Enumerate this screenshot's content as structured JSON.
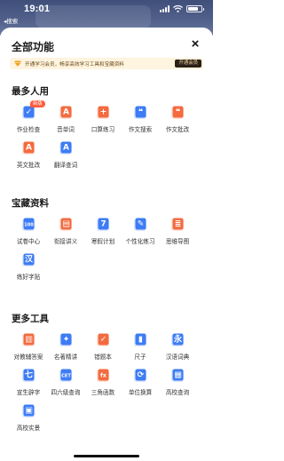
{
  "status": {
    "time": "19:01",
    "back_label": "◂搜索"
  },
  "sheet": {
    "title": "全部功能",
    "close": "×",
    "promo": {
      "text": "开通学习会员，畅享高效学习工具和宝藏资料",
      "button": "开通会员"
    }
  },
  "sections": [
    {
      "title": "最多人用",
      "items": [
        {
          "label": "作业检查",
          "icon": "homework-check-icon",
          "badge": "新版"
        },
        {
          "label": "音单词",
          "icon": "word-dictation-icon"
        },
        {
          "label": "口算练习",
          "icon": "mental-math-icon"
        },
        {
          "label": "作文搜索",
          "icon": "essay-search-icon"
        },
        {
          "label": "作文批改",
          "icon": "essay-correction-icon"
        },
        {
          "label": "英文批改",
          "icon": "english-correction-icon"
        },
        {
          "label": "翻译查词",
          "icon": "translate-icon"
        }
      ]
    },
    {
      "title": "宝藏资料",
      "items": [
        {
          "label": "试卷中心",
          "icon": "exam-paper-icon"
        },
        {
          "label": "衔接讲义",
          "icon": "bridge-notes-icon"
        },
        {
          "label": "寒假计划",
          "icon": "winter-plan-icon"
        },
        {
          "label": "个性化练习",
          "icon": "personal-practice-icon"
        },
        {
          "label": "思维导图",
          "icon": "mind-map-icon"
        },
        {
          "label": "练好字贴",
          "icon": "copybook-icon"
        }
      ]
    },
    {
      "title": "更多工具",
      "items": [
        {
          "label": "对教辅答案",
          "icon": "answer-book-icon"
        },
        {
          "label": "名著精讲",
          "icon": "classics-icon"
        },
        {
          "label": "错题本",
          "icon": "mistake-book-icon"
        },
        {
          "label": "尺子",
          "icon": "ruler-icon"
        },
        {
          "label": "汉语词典",
          "icon": "dictionary-icon"
        },
        {
          "label": "宣生辟字",
          "icon": "rare-char-icon"
        },
        {
          "label": "四六级查询",
          "icon": "cet-icon"
        },
        {
          "label": "三角函数",
          "icon": "trig-icon"
        },
        {
          "label": "单位换算",
          "icon": "unit-convert-icon"
        },
        {
          "label": "高校查询",
          "icon": "university-icon"
        },
        {
          "label": "高校实景",
          "icon": "campus-view-icon"
        }
      ]
    }
  ],
  "colors": {
    "blue": "#3d7cf5",
    "orange": "#f36b3f",
    "gold": "#e3a636",
    "dark": "#2b2118"
  },
  "icon_glyphs": {
    "homework-check-icon": "✓",
    "word-dictation-icon": "A",
    "mental-math-icon": "+",
    "essay-search-icon": "❝",
    "essay-correction-icon": "❝",
    "english-correction-icon": "A",
    "translate-icon": "A",
    "exam-paper-icon": "100",
    "bridge-notes-icon": "▤",
    "winter-plan-icon": "7",
    "personal-practice-icon": "✎",
    "mind-map-icon": "≣",
    "copybook-icon": "汉",
    "answer-book-icon": "▥",
    "classics-icon": "✦",
    "mistake-book-icon": "✓",
    "ruler-icon": "▮",
    "dictionary-icon": "永",
    "rare-char-icon": "七",
    "cet-icon": "CET",
    "trig-icon": "fx",
    "unit-convert-icon": "⟳",
    "university-icon": "▦",
    "campus-view-icon": "▣"
  }
}
